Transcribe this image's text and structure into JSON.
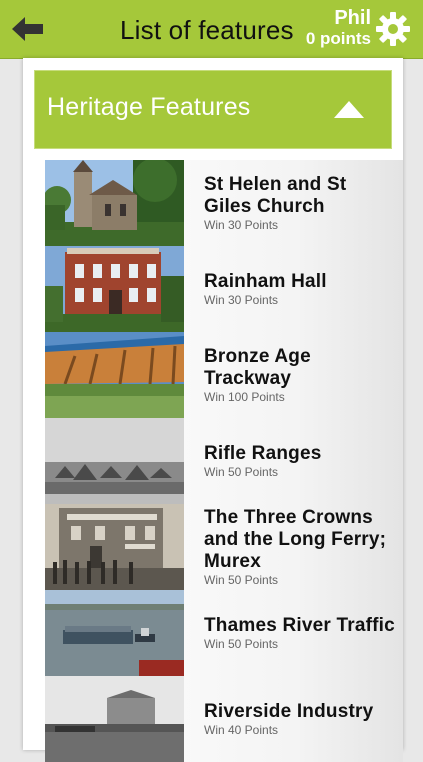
{
  "header": {
    "title": "List of features",
    "user_name": "Phil",
    "user_points": "0 points",
    "back_icon": "arrow-left-icon",
    "settings_icon": "gear-icon"
  },
  "section": {
    "title": "Heritage Features",
    "toggle_icon": "triangle-up-icon"
  },
  "features": [
    {
      "name": "St Helen and St Giles Church",
      "points": "Win 30 Points",
      "image": "church-photo"
    },
    {
      "name": "Rainham Hall",
      "points": "Win 30 Points",
      "image": "hall-photo"
    },
    {
      "name": "Bronze Age Trackway",
      "points": "Win 100 Points",
      "image": "trackway-photo"
    },
    {
      "name": "Rifle Ranges",
      "points": "Win 50 Points",
      "image": "rifle-ranges-photo"
    },
    {
      "name": "The Three Crowns and the Long Ferry; Murex",
      "points": "Win 50 Points",
      "image": "three-crowns-photo"
    },
    {
      "name": "Thames River Traffic",
      "points": "Win 50 Points",
      "image": "river-traffic-photo"
    },
    {
      "name": "Riverside Industry",
      "points": "Win 40 Points",
      "image": "riverside-industry-photo"
    }
  ],
  "colors": {
    "accent": "#a5c83a",
    "text": "#111111",
    "subtext": "#666666"
  }
}
